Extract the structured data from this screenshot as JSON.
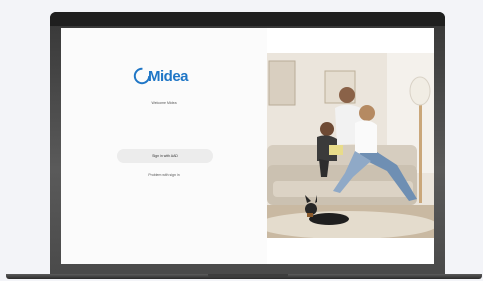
{
  "login": {
    "brand": "Midea",
    "welcome_text": "Welcome Midea",
    "signin_label": "Sign in with AAD",
    "forgot_link": "Problem with sign in"
  },
  "colors": {
    "brand_blue": "#1f76c6",
    "bezel": "#2e2e2e",
    "background": "#f3f4f8"
  },
  "icons": [
    "midea-logo-icon"
  ]
}
